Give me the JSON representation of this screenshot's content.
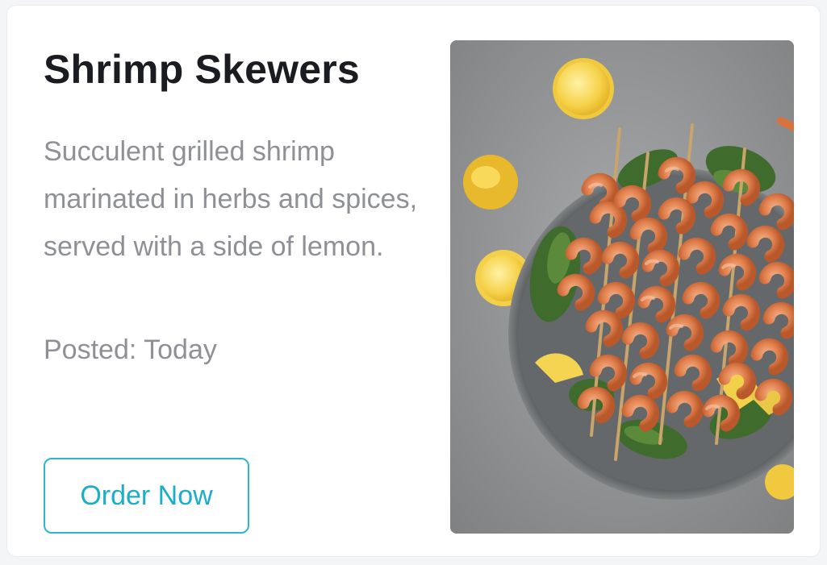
{
  "card": {
    "title": "Shrimp Skewers",
    "description": "Succulent grilled shrimp marinated in herbs and spices, served with a side of lemon.",
    "posted": "Posted: Today",
    "order_button_label": "Order Now",
    "image_alt": "Shrimp Skewers"
  },
  "colors": {
    "title": "#1b1c21",
    "muted_text": "#8e9096",
    "accent": "#2ab7cf"
  },
  "icons": {
    "photo": "food-photo"
  }
}
